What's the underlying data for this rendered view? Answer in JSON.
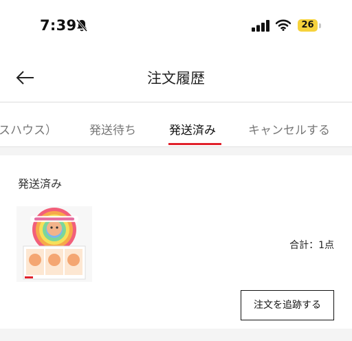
{
  "status_bar": {
    "time": "7:39",
    "battery": "26"
  },
  "header": {
    "title": "注文履歴"
  },
  "tabs": [
    {
      "label": "スハウス）",
      "active": false
    },
    {
      "label": "発送待ち",
      "active": false
    },
    {
      "label": "発送済み",
      "active": true
    },
    {
      "label": "キャンセルする",
      "active": false
    }
  ],
  "order": {
    "status": "発送済み",
    "total": "合計：1点",
    "track_label": "注文を追跡する"
  },
  "colors": {
    "accent": "#e1202a",
    "battery": "#f6d23c"
  }
}
